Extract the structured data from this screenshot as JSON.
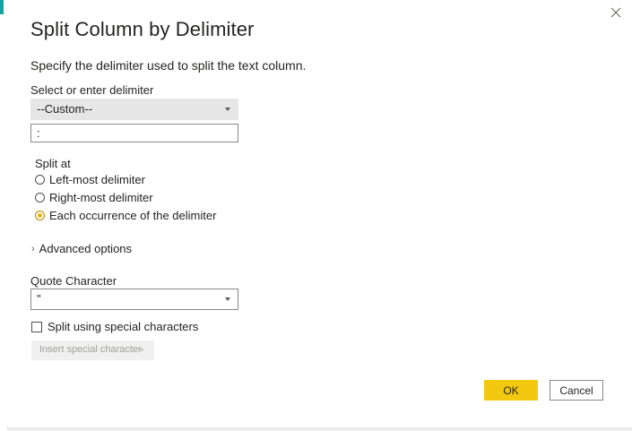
{
  "dialog": {
    "title": "Split Column by Delimiter",
    "description": "Specify the delimiter used to split the text column.",
    "close_icon": "close-icon"
  },
  "delimiter": {
    "label": "Select or enter delimiter",
    "selected": "--Custom--",
    "custom_value": ":"
  },
  "split_at": {
    "label": "Split at",
    "options": [
      {
        "label": "Left-most delimiter",
        "checked": false
      },
      {
        "label": "Right-most delimiter",
        "checked": false
      },
      {
        "label": "Each occurrence of the delimiter",
        "checked": true
      }
    ]
  },
  "advanced": {
    "label": "Advanced options",
    "icon": "chevron-right-icon"
  },
  "quote": {
    "label": "Quote Character",
    "selected": "\""
  },
  "special": {
    "checkbox_label": "Split using special characters",
    "checked": false,
    "insert_button_label": "Insert special character"
  },
  "buttons": {
    "ok": "OK",
    "cancel": "Cancel"
  },
  "colors": {
    "accent": "#f2c811",
    "radio_selected": "#e8b600",
    "dropdown_gray": "#e6e6e6"
  }
}
